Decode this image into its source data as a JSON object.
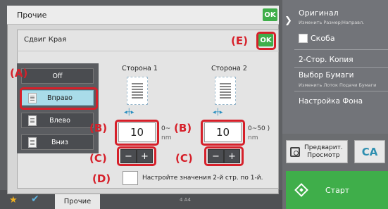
{
  "outer": {
    "title": "Прочие",
    "ok_label": "OK"
  },
  "inner": {
    "title": "Сдвиг Края",
    "ok_label": "OK"
  },
  "options": [
    {
      "label": "Off",
      "selected": false
    },
    {
      "label": "Вправо",
      "selected": true
    },
    {
      "label": "Влево",
      "selected": false
    },
    {
      "label": "Вниз",
      "selected": false
    }
  ],
  "side1": {
    "label": "Сторона 1",
    "value": "10",
    "range": "0~",
    "unit": "nm",
    "minus": "−",
    "plus": "+"
  },
  "side2": {
    "label": "Сторона 2",
    "value": "10",
    "range": "0~50 )",
    "unit": "nm",
    "minus": "−",
    "plus": "+"
  },
  "opposite": {
    "label": "Настройте значения 2-й стр. по 1-й."
  },
  "callouts": {
    "A": "(A)",
    "B": "(B)",
    "C": "(C)",
    "D": "(D)",
    "E": "(E)"
  },
  "right_panel": {
    "original_title": "Оригинал",
    "original_sub": "Изменить Размер/Направл.",
    "staple": "Скоба",
    "duplex": "2-Стор. Копия",
    "paper": "Выбор Бумаги",
    "paper_sub": "Изменить Лоток Подачи Бумаги",
    "background": "Настройка Фона",
    "preview_line1": "Предварит.",
    "preview_line2": "Просмотр",
    "ca": "CA",
    "start": "Старт"
  },
  "bottom": {
    "tab_label": "Прочие",
    "tray_info": "4   A4"
  },
  "colors": {
    "accent_green": "#3fae4a",
    "callout_red": "#d6202a",
    "selected_blue": "#a9dce9"
  }
}
